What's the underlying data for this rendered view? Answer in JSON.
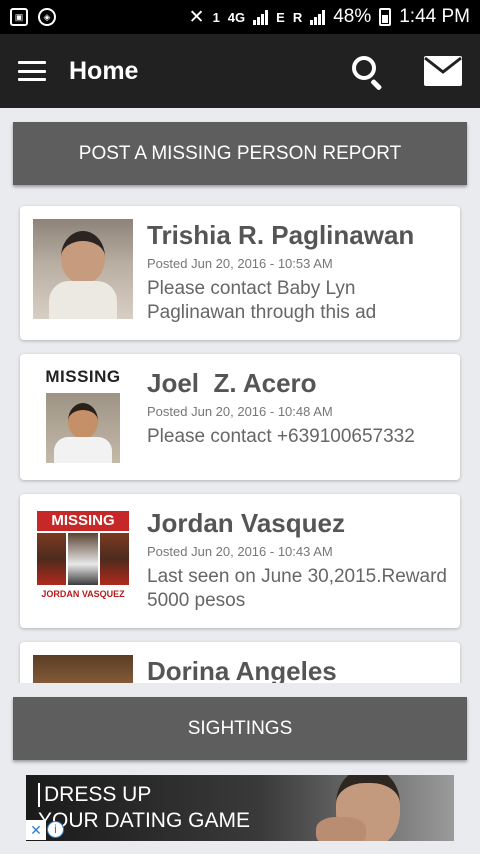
{
  "status_bar": {
    "network_type": "4G",
    "network_sub": "E",
    "roaming": "R",
    "battery": "48%",
    "time": "1:44 PM",
    "sim_slot": "1"
  },
  "app_bar": {
    "title": "Home",
    "icons": [
      "menu-icon",
      "search-icon",
      "mail-icon"
    ]
  },
  "post_button": {
    "label": "POST A MISSING PERSON REPORT"
  },
  "reports": [
    {
      "name": "Trishia R. Paglinawan",
      "posted": "Posted Jun 20, 2016 - 10:53 AM",
      "description": "Please contact Baby Lyn Paglinawan through this ad"
    },
    {
      "name": "Joel  Z. Acero",
      "posted": "Posted Jun 20, 2016 - 10:48 AM",
      "description": "Please contact +639100657332",
      "thumb_label": "MISSING"
    },
    {
      "name": "Jordan Vasquez",
      "posted": "Posted Jun 20, 2016 - 10:43 AM",
      "description": "Last seen on June 30,2015.Reward 5000 pesos",
      "thumb_label": "MISSING",
      "thumb_caption": "JORDAN VASQUEZ"
    },
    {
      "name": "Dorina Angeles"
    }
  ],
  "sightings_button": {
    "label": "SIGHTINGS"
  },
  "ad": {
    "line1": "DRESS UP",
    "line2": "YOUR DATING GAME",
    "close_icon": "x-icon",
    "info_icon": "info-icon"
  },
  "colors": {
    "app_bar": "#212121",
    "button": "#5e5e5e",
    "background": "#e9ebee",
    "missing_red": "#c62828"
  }
}
